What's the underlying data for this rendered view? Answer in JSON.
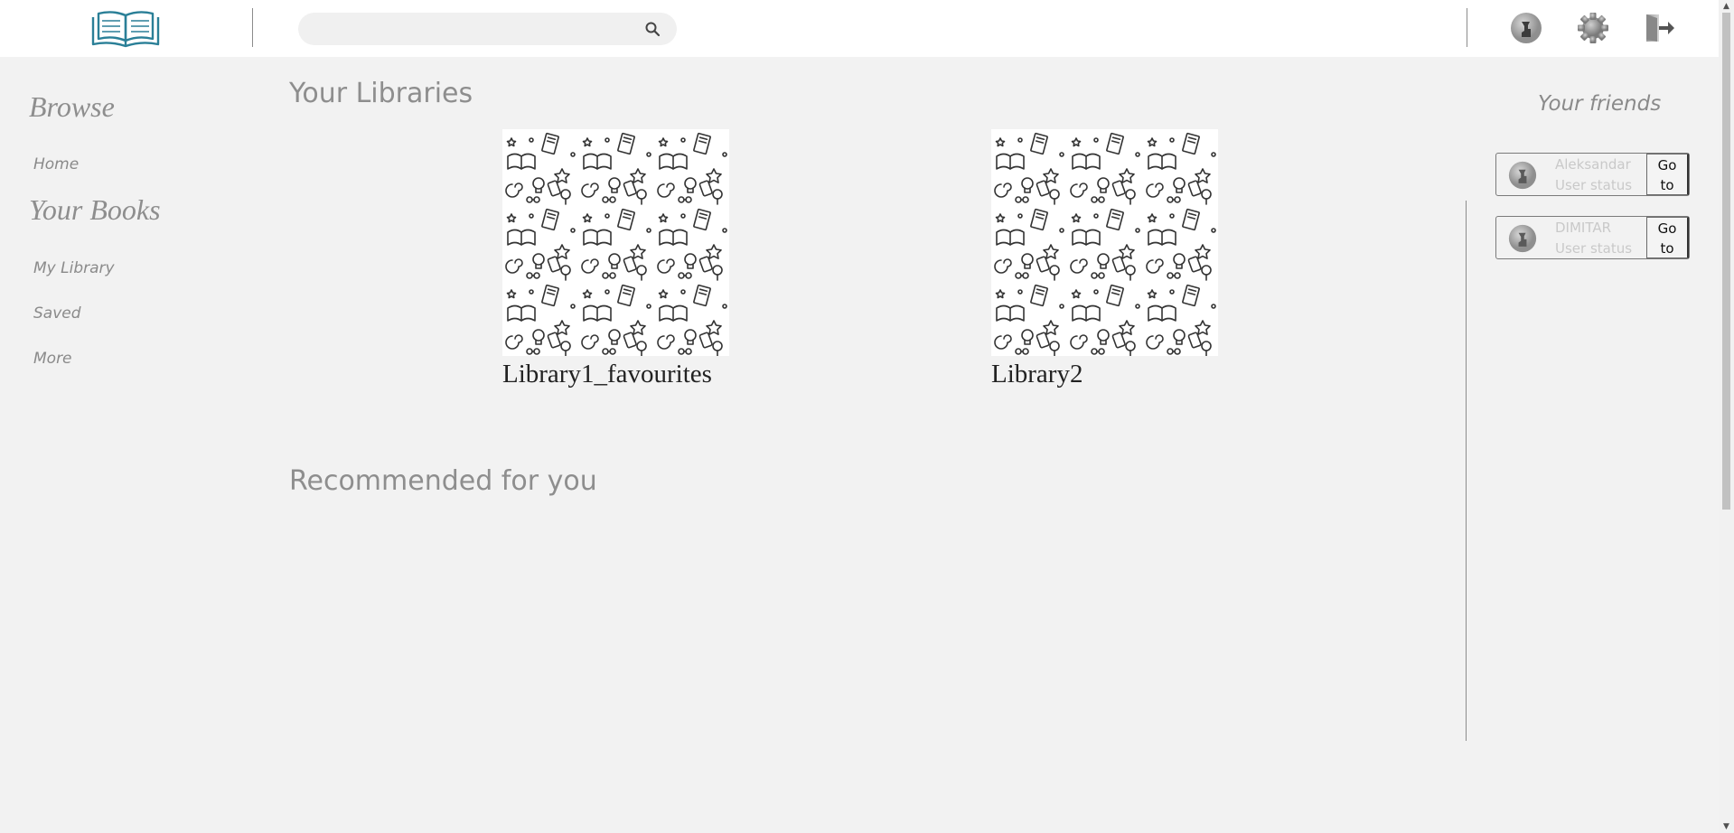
{
  "search": {
    "value": "",
    "placeholder": ""
  },
  "sidebar": {
    "browse_heading": "Browse",
    "home_label": "Home",
    "your_books_heading": "Your Books",
    "items": [
      {
        "label": "My Library"
      },
      {
        "label": "Saved"
      },
      {
        "label": "More"
      }
    ]
  },
  "main": {
    "libraries_heading": "Your Libraries",
    "libraries": [
      {
        "title": "Library1_favourites"
      },
      {
        "title": "Library2"
      }
    ],
    "recommended_heading": "Recommended for you"
  },
  "friends": {
    "heading": "Your friends",
    "items": [
      {
        "name": "Aleksandar",
        "status": "User status",
        "button": "Go to"
      },
      {
        "name": "DIMITAR",
        "status": "User status",
        "button": "Go to"
      }
    ]
  },
  "icons": {
    "logo": "open-book-icon",
    "search": "search-icon",
    "profile": "user-avatar-icon",
    "settings": "gear-icon",
    "logout": "logout-icon"
  },
  "colors": {
    "logo_accent": "#2a7f97",
    "background": "#f2f2f2",
    "muted_text": "#8e8e8e"
  }
}
